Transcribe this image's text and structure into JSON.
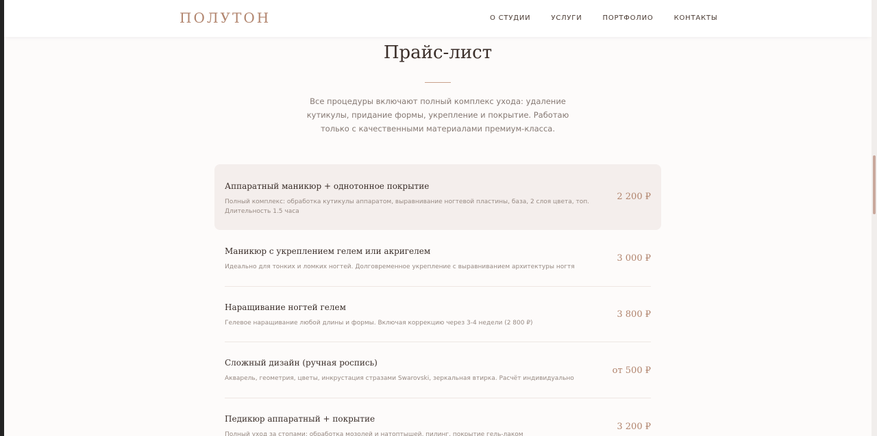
{
  "header": {
    "logo": "ПОЛУТОН",
    "nav": [
      "О СТУДИИ",
      "УСЛУГИ",
      "ПОРТФОЛИО",
      "КОНТАКТЫ"
    ]
  },
  "pricing": {
    "title": "Прайс-лист",
    "intro": "Все процедуры включают полный комплекс ухода: удаление кутикулы, придание формы, укрепление и покрытие. Работаю только с качественными материалами премиум-класса.",
    "items": [
      {
        "name": "Аппаратный маникюр + однотонное покрытие",
        "desc": "Полный комплекс: обработка кутикулы аппаратом, выравнивание ногтевой пластины, база, 2 слоя цвета, топ. Длительность 1.5 часа",
        "price": "2 200 ₽"
      },
      {
        "name": "Маникюр с укреплением гелем или акригелем",
        "desc": "Идеально для тонких и ломких ногтей. Долговременное укрепление с выравниванием архитектуры ногтя",
        "price": "3 000 ₽"
      },
      {
        "name": "Наращивание ногтей гелем",
        "desc": "Гелевое наращивание любой длины и формы. Включая коррекцию через 3-4 недели (2 800 ₽)",
        "price": "3 800 ₽"
      },
      {
        "name": "Сложный дизайн (ручная роспись)",
        "desc": "Акварель, геометрия, цветы, инкрустация стразами Swarovski, зеркальная втирка. Расчёт индивидуально",
        "price": "от 500 ₽"
      },
      {
        "name": "Педикюр аппаратный + покрытие",
        "desc": "Полный уход за стопами: обработка мозолей и натоптышей, пилинг, покрытие гель-лаком",
        "price": "3 200 ₽"
      }
    ]
  },
  "colors": {
    "accent": "#b1846d",
    "text": "#3a2e29",
    "highlight_bg": "#f4eeec"
  }
}
